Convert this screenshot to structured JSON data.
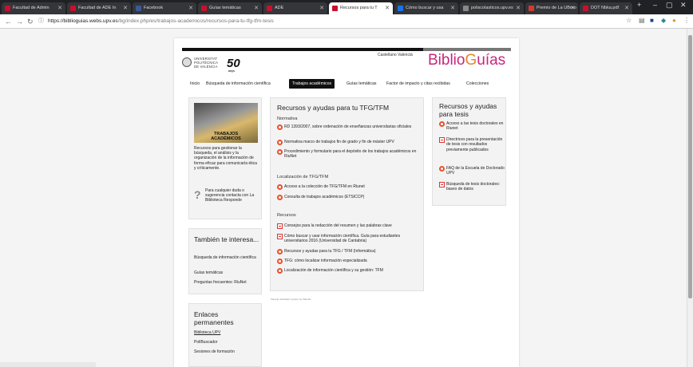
{
  "browser": {
    "tabs": [
      {
        "title": "Facultad de Admin",
        "favicon_color": "#c8102e"
      },
      {
        "title": "Facultad de ADE In",
        "favicon_color": "#c8102e"
      },
      {
        "title": "Facebook",
        "favicon_color": "#3b5998"
      },
      {
        "title": "Guías temáticas",
        "favicon_color": "#c8102e"
      },
      {
        "title": "ADE",
        "favicon_color": "#c8102e"
      },
      {
        "title": "Recursos para tu T",
        "favicon_color": "#c8102e"
      },
      {
        "title": "Cómo buscar y usa",
        "favicon_color": "#1a73e8"
      },
      {
        "title": "poliscolasticos.upv.es",
        "favicon_color": "#888888"
      },
      {
        "title": "Premio de La UBrno",
        "favicon_color": "#d23b2f"
      },
      {
        "title": "DOT Nbka.pdf",
        "favicon_color": "#c8102e"
      }
    ],
    "url_host": "https://biblioguias.webs.upv.es",
    "url_path": "/bg/index.php/es/trabajos-academicos/recursos-para-tu-tfg-tfm-tesis",
    "new_tab": "+",
    "win_min": "–",
    "win_max": "▢",
    "win_close": "✕"
  },
  "header": {
    "university": [
      "UNIVERSITAT",
      "POLITÈCNICA",
      "DE VALÈNCIA"
    ],
    "anniversary_number": "50",
    "anniversary_label": "anys",
    "lang_castellano": "Castellano",
    "lang_valencia": "Valencià",
    "brand_biblio": "Biblio",
    "brand_g": "G",
    "brand_uias": "uías"
  },
  "menu": [
    {
      "label": "Inicio",
      "active": false
    },
    {
      "label": "Búsqueda de información científica",
      "active": false
    },
    {
      "label": "Trabajos académicos",
      "active": true
    },
    {
      "label": "Guías temáticas",
      "active": false
    },
    {
      "label": "Factor de impacto y citas recibidas",
      "active": false
    },
    {
      "label": "Colecciones",
      "active": false
    }
  ],
  "sidebar": {
    "banner_title": [
      "TRABAJOS",
      "ACADÉMICOS"
    ],
    "description": "Recursos para gestionar la búsqueda, el análisis y la organización de la información de forma eficaz para comunicarla ética y críticamente.",
    "question_text": "Para cualquier duda o sugerencia contacta con La Biblioteca Responde",
    "related_title": "También te interesa...",
    "related_links": [
      "Búsqueda de información científica",
      "Guías temáticas",
      "Preguntas frecuentes: RiuNet"
    ],
    "permalinks_title": "Enlaces permanentes",
    "permalinks": [
      "Biblioteca UPV",
      "PoliBuscador",
      "Sesiones de formación"
    ]
  },
  "main": {
    "title": "Recursos y ayudas para tu TFG/TFM",
    "sections": [
      {
        "heading": "Normativa",
        "items": [
          {
            "text": "RD 1393/2007, sobre ordenación de enseñanzas universitarias oficiales",
            "icon": "star"
          },
          {
            "text": "Normativa marco de trabajos fin de grado y fin de máster UPV",
            "icon": "star"
          },
          {
            "text": "Procedimiento y formulario para el depósito de los trabajos académicos en RiuNet",
            "icon": "star"
          }
        ]
      },
      {
        "heading": "Localización de TFG/TFM",
        "items": [
          {
            "text": "Acceso a la colección de TFG/TFM en Riunet",
            "icon": "star"
          },
          {
            "text": "Consulta de trabajos académicos (ETSICCP)",
            "icon": "star"
          }
        ]
      },
      {
        "heading": "Recursos",
        "items": [
          {
            "text": "Consejos para la redacción del resumen y las palabras clave",
            "icon": "pdf"
          },
          {
            "text": "Cómo buscar y usar información científica. Guía para estudiantes universitarios 2016 (Universidad de Cantabria)",
            "icon": "pdf"
          },
          {
            "text": "Recursos y ayudas para tu TFG / TFM (Informática)",
            "icon": "star"
          },
          {
            "text": "TFG: cómo localizar información especializada",
            "icon": "star"
          },
          {
            "text": "Localización de información científica y su gestión: TFM",
            "icon": "star"
          }
        ]
      }
    ],
    "footer_note": "FaLang translation system by Faboba"
  },
  "right": {
    "title": "Recursos y ayudas para tesis",
    "items": [
      {
        "text": "Acceso a las tesis doctorales en Riunet",
        "icon": "star"
      },
      {
        "text": "Directrices para la presentación de tesis con resultados previamente publicados",
        "icon": "pdf"
      },
      {
        "text": "FAQ de la Escuela de Doctorado UPV",
        "icon": "star"
      },
      {
        "text": "Búsqueda de tesis doctorales: bases de datos",
        "icon": "pdf"
      }
    ]
  }
}
